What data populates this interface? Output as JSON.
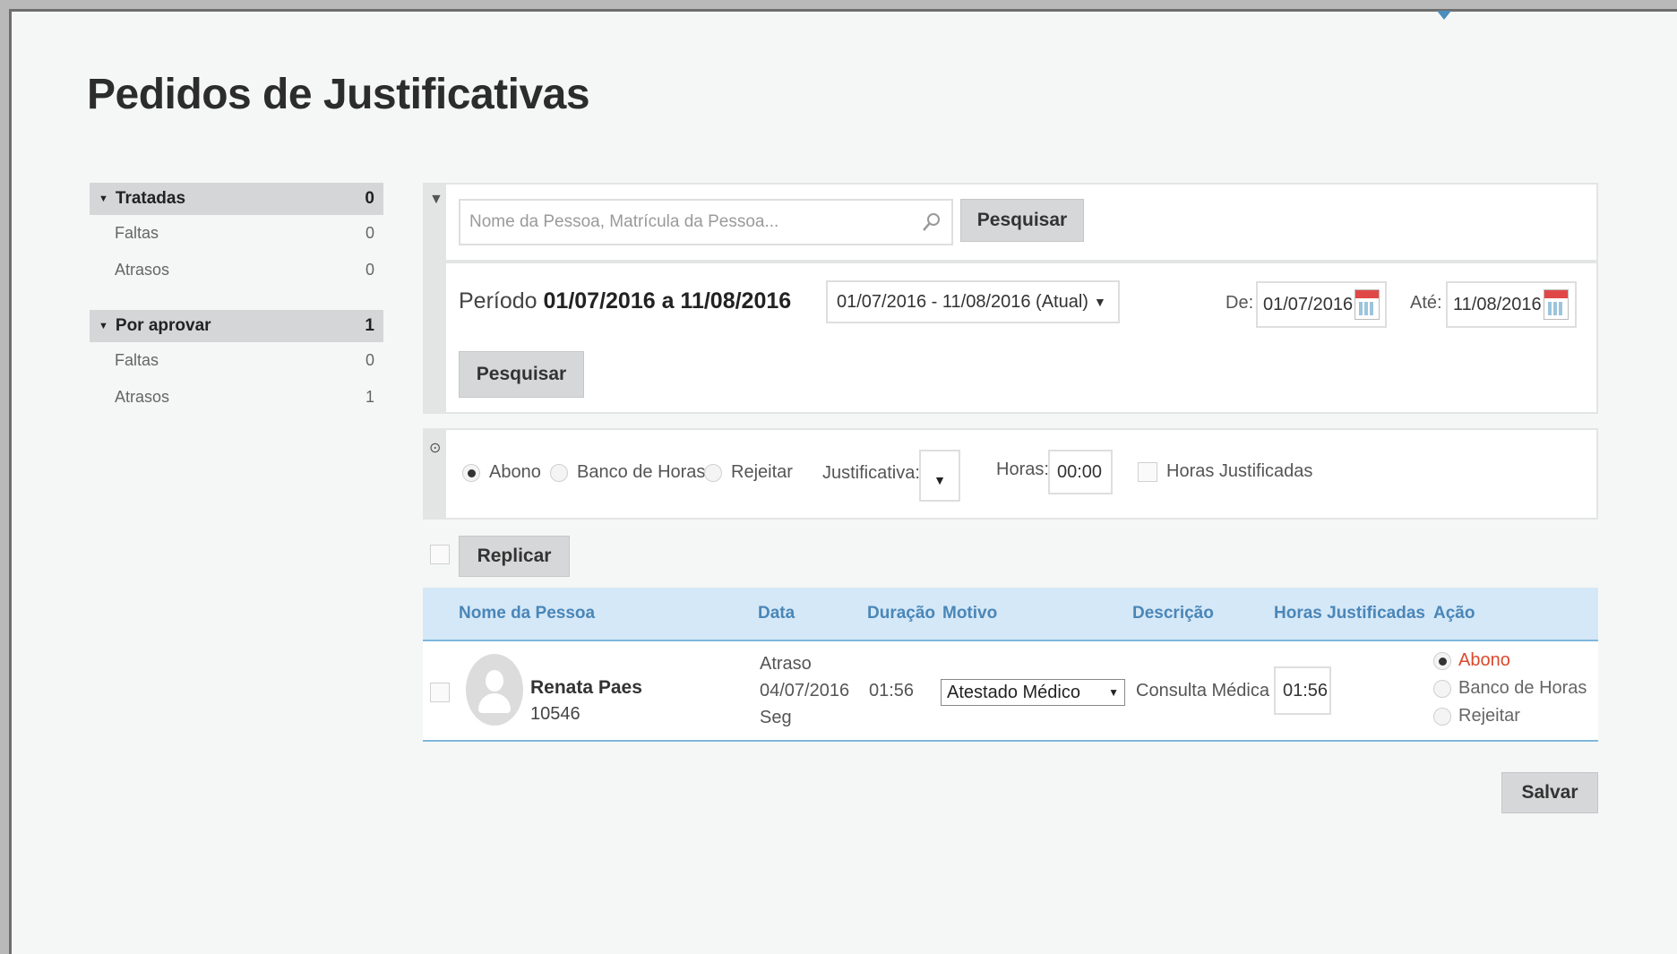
{
  "page": {
    "title": "Pedidos de Justificativas"
  },
  "sidebar": {
    "groups": [
      {
        "label": "Tratadas",
        "count": "0",
        "items": [
          {
            "label": "Faltas",
            "count": "0"
          },
          {
            "label": "Atrasos",
            "count": "0"
          }
        ]
      },
      {
        "label": "Por aprovar",
        "count": "1",
        "items": [
          {
            "label": "Faltas",
            "count": "0"
          },
          {
            "label": "Atrasos",
            "count": "1"
          }
        ]
      }
    ]
  },
  "filter": {
    "search_placeholder": "Nome da Pessoa, Matrícula da Pessoa...",
    "search_button": "Pesquisar",
    "periodo_label": "Período",
    "periodo_value": "01/07/2016 a 11/08/2016",
    "period_select": "01/07/2016 - 11/08/2016 (Atual)",
    "de_label": "De:",
    "de_value": "01/07/2016",
    "ate_label": "Até:",
    "ate_value": "11/08/2016",
    "pesquisar_button": "Pesquisar"
  },
  "bulk": {
    "options": [
      {
        "label": "Abono",
        "selected": true
      },
      {
        "label": "Banco de Horas",
        "selected": false
      },
      {
        "label": "Rejeitar",
        "selected": false
      }
    ],
    "justificativa_label": "Justificativa:",
    "horas_label": "Horas:",
    "horas_value": "00:00",
    "horas_justificadas_label": "Horas Justificadas",
    "replicar_button": "Replicar"
  },
  "table": {
    "columns": [
      "Nome da Pessoa",
      "Data",
      "Duração",
      "Motivo",
      "Descrição",
      "Horas Justificadas",
      "Ação"
    ],
    "rows": [
      {
        "name": "Renata Paes",
        "matricula": "10546",
        "tipo": "Atraso",
        "data": "04/07/2016",
        "dia": "Seg",
        "duracao": "01:56",
        "motivo": "Atestado Médico",
        "descricao": "Consulta Médica",
        "horas_justificadas": "01:56",
        "acoes": [
          "Abono",
          "Banco de Horas",
          "Rejeitar"
        ],
        "acao_selected": "Abono"
      }
    ]
  },
  "footer": {
    "save_button": "Salvar"
  },
  "colors": {
    "accent": "#4a86b8",
    "header_bg": "#d4e8f7",
    "selected_action": "#d9492c"
  }
}
